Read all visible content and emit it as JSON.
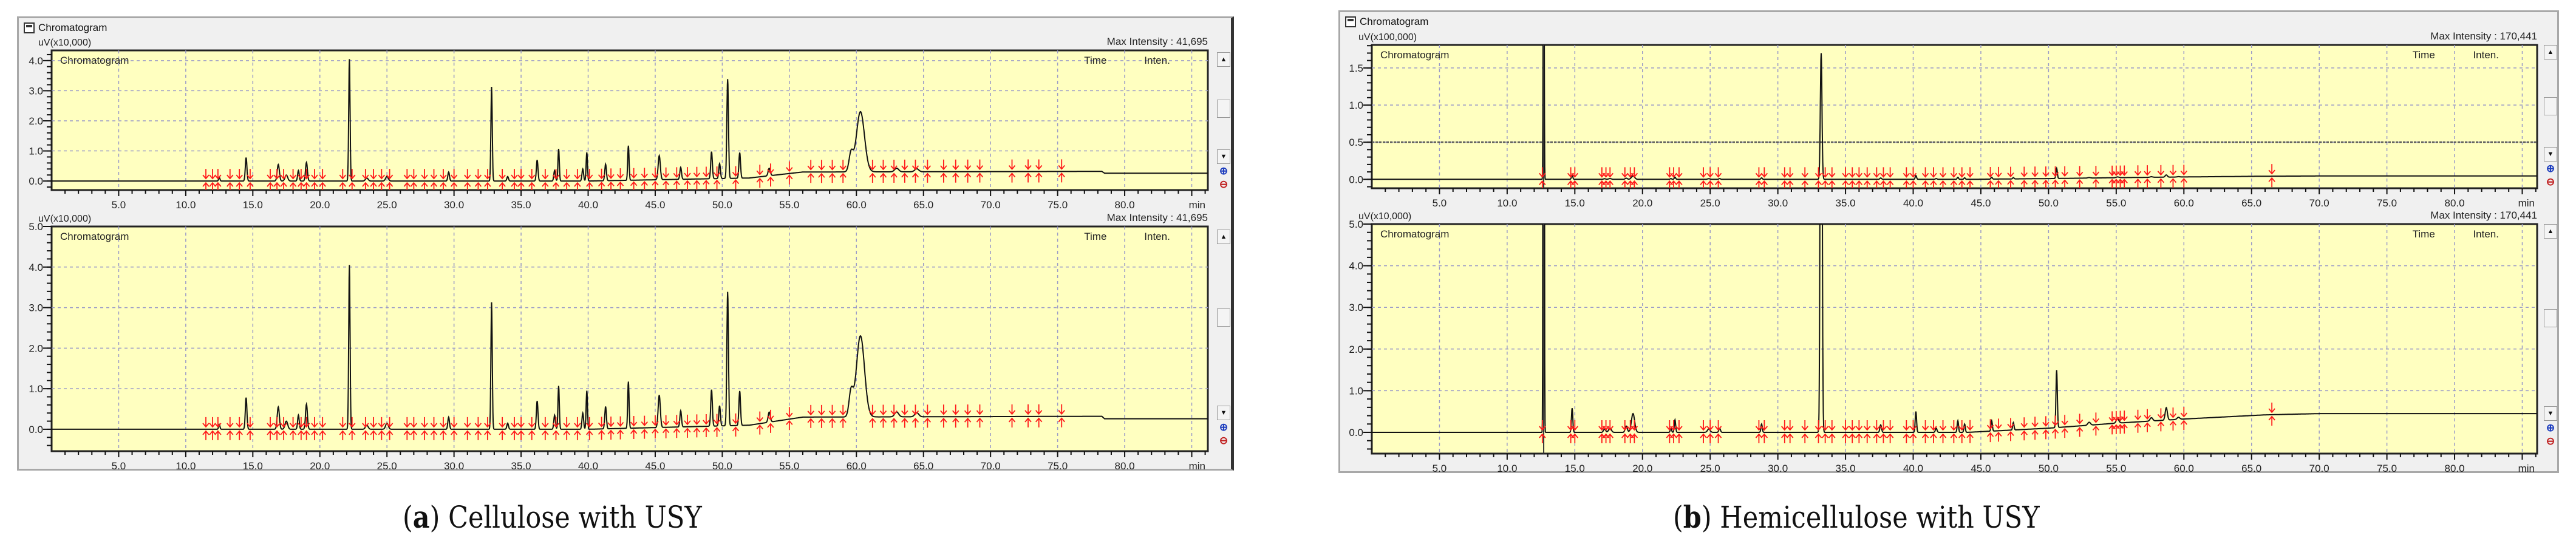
{
  "panels": {
    "a": {
      "window_title": "Chromatogram",
      "caption_letter": "a",
      "caption_text": "Cellulose with USY"
    },
    "b": {
      "window_title": "Chromatogram",
      "caption_letter": "b",
      "caption_text": "Hemicellulose with USY"
    }
  },
  "controls": {
    "scroll_up": "▲",
    "scroll_down": "▼",
    "zoom_in": "⊕",
    "zoom_out": "⊖"
  },
  "colors": {
    "plot_bg": "#ffffc0",
    "trace": "#111111",
    "marker": "#ff1a1a",
    "grid": "#9a9ac8"
  },
  "chart_data": [
    {
      "panel": "a",
      "type": "line",
      "title": "Chromatogram",
      "ylabel": "uV(x10,000)",
      "xlabel": "min",
      "max_intensity": "Max Intensity :  41,695",
      "col_time": "Time",
      "col_inten": "Inten.",
      "xlim": [
        0,
        86.2
      ],
      "ylim": [
        -0.3,
        4.34
      ],
      "xticks": [
        "5.0",
        "10.0",
        "15.0",
        "20.0",
        "25.0",
        "30.0",
        "35.0",
        "40.0",
        "45.0",
        "50.0",
        "55.0",
        "60.0",
        "65.0",
        "70.0",
        "75.0",
        "80.0"
      ],
      "yticks": [
        "0.0",
        "1.0",
        "2.0",
        "3.0",
        "4.0"
      ],
      "series": "cellulose",
      "y_scale": 1
    },
    {
      "panel": "a",
      "type": "line",
      "title": "Chromatogram",
      "ylabel": "uV(x10,000)",
      "xlabel": "min",
      "max_intensity": "Max Intensity :  41,695",
      "col_time": "Time",
      "col_inten": "Inten.",
      "xlim": [
        0,
        86.2
      ],
      "ylim": [
        -0.54,
        5.0
      ],
      "xticks": [
        "5.0",
        "10.0",
        "15.0",
        "20.0",
        "25.0",
        "30.0",
        "35.0",
        "40.0",
        "45.0",
        "50.0",
        "55.0",
        "60.0",
        "65.0",
        "70.0",
        "75.0",
        "80.0"
      ],
      "yticks": [
        "0.0",
        "1.0",
        "2.0",
        "3.0",
        "4.0",
        "5.0"
      ],
      "series": "cellulose",
      "y_scale": 1
    },
    {
      "panel": "b",
      "type": "line",
      "title": "Chromatogram",
      "ylabel": "uV(x100,000)",
      "xlabel": "min",
      "max_intensity": "Max Intensity : 170,441",
      "col_time": "Time",
      "col_inten": "Inten.",
      "xlim": [
        0,
        86.1
      ],
      "ylim": [
        -0.12,
        1.81
      ],
      "xticks": [
        "5.0",
        "10.0",
        "15.0",
        "20.0",
        "25.0",
        "30.0",
        "35.0",
        "40.0",
        "45.0",
        "50.0",
        "55.0",
        "60.0",
        "65.0",
        "70.0",
        "75.0",
        "80.0"
      ],
      "yticks": [
        "0.0",
        "0.5",
        "1.0",
        "1.5"
      ],
      "series": "hemicellulose",
      "y_scale": 0.1,
      "reference_line": 0.5
    },
    {
      "panel": "b",
      "type": "line",
      "title": "Chromatogram",
      "ylabel": "uV(x10,000)",
      "xlabel": "min",
      "max_intensity": "Max Intensity : 170,441",
      "col_time": "Time",
      "col_inten": "Inten.",
      "xlim": [
        0,
        86.1
      ],
      "ylim": [
        -0.51,
        5.0
      ],
      "xticks": [
        "5.0",
        "10.0",
        "15.0",
        "20.0",
        "25.0",
        "30.0",
        "35.0",
        "40.0",
        "45.0",
        "50.0",
        "55.0",
        "60.0",
        "65.0",
        "70.0",
        "75.0",
        "80.0"
      ],
      "yticks": [
        "0.0",
        "1.0",
        "2.0",
        "3.0",
        "4.0",
        "5.0"
      ],
      "series": "hemicellulose",
      "y_scale": 1
    }
  ],
  "series": {
    "cellulose": {
      "unit": "uV x10,000",
      "baseline": [
        [
          0,
          0
        ],
        [
          40,
          0
        ],
        [
          52,
          0.1
        ],
        [
          56,
          0.3
        ],
        [
          78.3,
          0.32
        ],
        [
          78.5,
          0.26
        ],
        [
          86.2,
          0.26
        ]
      ],
      "peaks": [
        [
          12.5,
          0.12,
          0.05
        ],
        [
          14.5,
          0.78,
          0.06
        ],
        [
          16.9,
          0.55,
          0.08
        ],
        [
          17.5,
          0.2,
          0.1
        ],
        [
          18.4,
          0.35,
          0.06
        ],
        [
          19.0,
          0.62,
          0.07
        ],
        [
          22.2,
          4.05,
          0.05
        ],
        [
          23.5,
          0.1,
          0.1
        ],
        [
          25.0,
          0.15,
          0.1
        ],
        [
          29.6,
          0.3,
          0.06
        ],
        [
          32.8,
          3.13,
          0.05
        ],
        [
          34.0,
          0.15,
          0.06
        ],
        [
          36.2,
          0.7,
          0.06
        ],
        [
          37.5,
          0.35,
          0.06
        ],
        [
          37.8,
          1.07,
          0.05
        ],
        [
          39.6,
          0.4,
          0.06
        ],
        [
          39.9,
          0.95,
          0.05
        ],
        [
          41.3,
          0.55,
          0.06
        ],
        [
          43.0,
          1.15,
          0.05
        ],
        [
          45.3,
          0.8,
          0.08
        ],
        [
          46.9,
          0.4,
          0.06
        ],
        [
          49.2,
          0.9,
          0.06
        ],
        [
          49.8,
          0.5,
          0.06
        ],
        [
          50.4,
          3.3,
          0.06
        ],
        [
          51.3,
          0.85,
          0.06
        ],
        [
          53.5,
          0.25,
          0.08
        ],
        [
          59.6,
          0.6,
          0.15
        ],
        [
          60.3,
          2.0,
          0.3
        ],
        [
          63.0,
          0.12,
          0.15
        ],
        [
          64.5,
          0.1,
          0.15
        ]
      ],
      "markers": [
        11.5,
        12.0,
        12.4,
        13.3,
        14.0,
        14.8,
        16.3,
        16.8,
        17.3,
        18.0,
        18.6,
        19.0,
        19.6,
        20.2,
        21.7,
        22.4,
        23.4,
        24.0,
        24.6,
        25.2,
        26.5,
        27.0,
        27.8,
        28.5,
        29.2,
        30.0,
        31.0,
        31.8,
        32.5,
        33.6,
        34.5,
        35.0,
        35.8,
        36.8,
        37.6,
        38.4,
        39.2,
        40.1,
        41.0,
        41.7,
        42.4,
        43.4,
        44.2,
        45.0,
        45.8,
        46.6,
        47.4,
        48.1,
        48.8,
        49.6,
        51.0,
        52.8,
        53.6,
        55.0,
        56.6,
        57.4,
        58.2,
        59.0,
        61.2,
        62.0,
        62.8,
        63.6,
        64.4,
        65.3,
        66.5,
        67.4,
        68.3,
        69.2,
        71.6,
        72.8,
        73.6,
        75.3
      ],
      "event_line": null
    },
    "hemicellulose": {
      "unit": "uV x10,000",
      "baseline": [
        [
          0,
          0
        ],
        [
          44,
          0
        ],
        [
          50,
          0.1
        ],
        [
          55,
          0.22
        ],
        [
          60,
          0.32
        ],
        [
          66,
          0.42
        ],
        [
          70,
          0.45
        ],
        [
          86.1,
          0.45
        ]
      ],
      "peaks": [
        [
          12.7,
          60,
          0.03
        ],
        [
          14.8,
          0.58,
          0.05
        ],
        [
          17.2,
          0.08,
          0.08
        ],
        [
          17.6,
          0.1,
          0.1
        ],
        [
          18.8,
          0.15,
          0.08
        ],
        [
          19.3,
          0.45,
          0.12
        ],
        [
          22.1,
          0.1,
          0.05
        ],
        [
          22.4,
          0.3,
          0.05
        ],
        [
          24.9,
          0.08,
          0.1
        ],
        [
          25.7,
          0.1,
          0.06
        ],
        [
          28.8,
          0.2,
          0.05
        ],
        [
          33.2,
          17.0,
          0.06
        ],
        [
          37.6,
          0.18,
          0.06
        ],
        [
          40.2,
          0.5,
          0.05
        ],
        [
          41.7,
          0.1,
          0.06
        ],
        [
          43.3,
          0.28,
          0.05
        ],
        [
          43.8,
          0.2,
          0.05
        ],
        [
          45.8,
          0.25,
          0.05
        ],
        [
          47.4,
          0.18,
          0.05
        ],
        [
          50.6,
          1.38,
          0.05
        ],
        [
          53.0,
          0.07,
          0.1
        ],
        [
          55.1,
          0.1,
          0.1
        ],
        [
          57.6,
          0.08,
          0.1
        ],
        [
          58.7,
          0.3,
          0.08
        ],
        [
          59.6,
          0.05,
          0.1
        ]
      ],
      "markers": [
        12.6,
        14.7,
        15.0,
        17.0,
        17.3,
        17.6,
        18.7,
        19.1,
        19.4,
        22.0,
        22.3,
        22.7,
        24.5,
        25.0,
        25.6,
        28.6,
        29.0,
        30.5,
        30.9,
        32.0,
        33.0,
        33.5,
        34.0,
        35.0,
        35.5,
        36.0,
        36.6,
        37.3,
        37.8,
        38.3,
        39.5,
        40.0,
        40.9,
        41.5,
        42.2,
        43.0,
        43.6,
        44.2,
        45.7,
        46.3,
        47.2,
        48.2,
        49.0,
        49.8,
        50.5,
        51.2,
        52.3,
        53.5,
        54.7,
        55.0,
        55.3,
        55.6,
        56.6,
        57.3,
        58.3,
        59.2,
        60.0,
        66.5
      ],
      "event_line": 12.7
    }
  }
}
